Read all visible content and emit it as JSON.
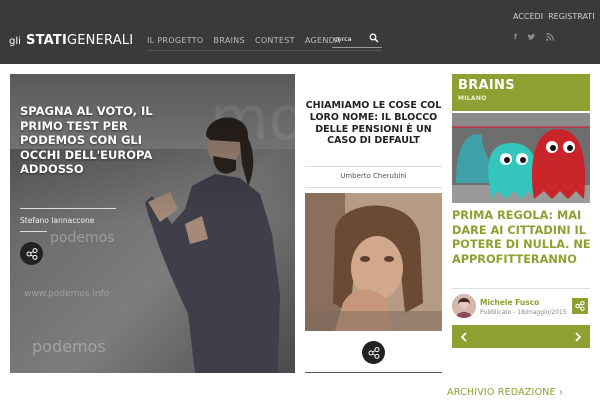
{
  "header": {
    "logo": {
      "prefix": "gli",
      "bold": "STATI",
      "rest": "GENERALI"
    },
    "nav": [
      {
        "label": "IL PROGETTO"
      },
      {
        "label": "BRAINS"
      },
      {
        "label": "CONTEST"
      },
      {
        "label": "AGENDA"
      }
    ],
    "search": {
      "placeholder": "cerca",
      "icon": "search-icon"
    },
    "account": {
      "login": "ACCEDI",
      "register": "REGISTRATI"
    },
    "social": [
      {
        "icon": "facebook-icon",
        "glyph": "f"
      },
      {
        "icon": "twitter-icon",
        "glyph": "t"
      },
      {
        "icon": "rss-icon",
        "glyph": "rss"
      }
    ]
  },
  "feature": {
    "title": "Spagna al voto, il primo test per Podemos con gli occhi dell'Europa addosso",
    "author": "Stefano Iannaccone",
    "share_icon": "share-icon"
  },
  "middle": {
    "title": "Chiamiamo le cose col loro nome: il blocco delle pensioni è un caso di default",
    "author": "Umberto Cherubini",
    "share_icon": "share-icon"
  },
  "sidebar": {
    "section": "BRAINS",
    "subsection": "MILANO",
    "title": "Prima regola: mai dare ai cittadini il potere di nulla. Ne approfitteranno",
    "author": "Michele Fusco",
    "date": "Pubblicato - 18/maggio/2015",
    "nav_prev_icon": "chevron-left-icon",
    "nav_next_icon": "chevron-right-icon"
  },
  "archive": {
    "label": "ARCHIVIO REDAZIONE  ›"
  },
  "colors": {
    "header_bg": "#3a3a3a",
    "accent": "#8fa032",
    "share_bg": "#222222"
  }
}
